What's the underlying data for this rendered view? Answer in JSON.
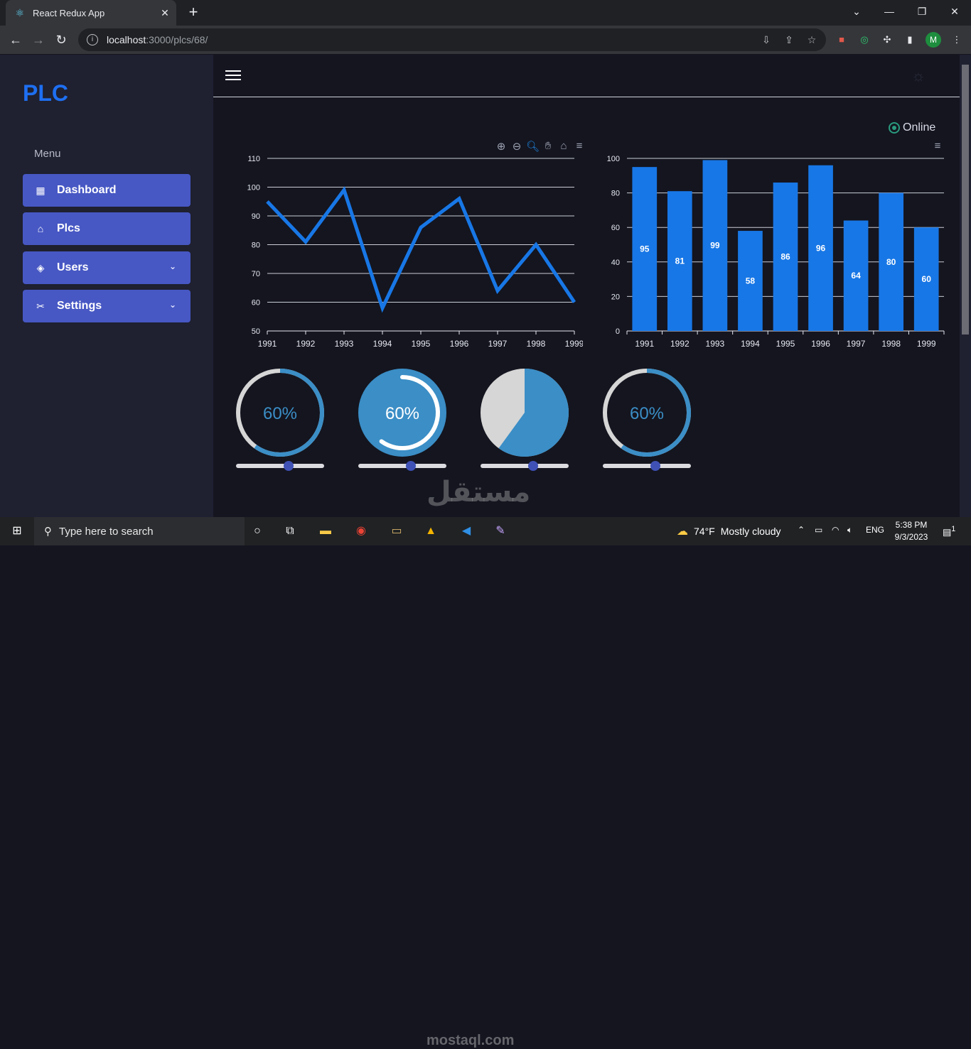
{
  "browser": {
    "tab_title": "React Redux App",
    "url_host": "localhost",
    "url_path": ":3000/plcs/68/",
    "profile_initial": "M"
  },
  "sidebar": {
    "brand": "PLC",
    "menu_label": "Menu",
    "items": [
      {
        "label": "Dashboard",
        "icon": "grid-icon",
        "has_chevron": false
      },
      {
        "label": "Plcs",
        "icon": "router-icon",
        "has_chevron": false
      },
      {
        "label": "Users",
        "icon": "layers-icon",
        "has_chevron": true
      },
      {
        "label": "Settings",
        "icon": "tools-icon",
        "has_chevron": true
      }
    ]
  },
  "status": {
    "label": "Online",
    "color": "#2a9a7e"
  },
  "chart_data": [
    {
      "type": "line",
      "categories": [
        "1991",
        "1992",
        "1993",
        "1994",
        "1995",
        "1996",
        "1997",
        "1998",
        "1999"
      ],
      "series": [
        {
          "values": [
            95,
            81,
            99,
            58,
            86,
            96,
            64,
            80,
            60
          ]
        }
      ],
      "yticks": [
        "50",
        "60",
        "70",
        "80",
        "90",
        "100",
        "110"
      ],
      "ylim": [
        50,
        110
      ],
      "color": "#1877e6",
      "grid": true
    },
    {
      "type": "bar",
      "categories": [
        "1991",
        "1992",
        "1993",
        "1994",
        "1995",
        "1996",
        "1997",
        "1998",
        "1999"
      ],
      "series": [
        {
          "values": [
            95,
            81,
            99,
            58,
            86,
            96,
            64,
            80,
            60
          ]
        }
      ],
      "yticks": [
        "0",
        "20",
        "40",
        "60",
        "80",
        "100"
      ],
      "ylim": [
        0,
        100
      ],
      "color": "#1877e6",
      "data_labels": [
        "95",
        "81",
        "99",
        "58",
        "86",
        "96",
        "64",
        "80",
        "60"
      ],
      "grid": true
    }
  ],
  "gauges": [
    {
      "label": "60%",
      "value": 0.6,
      "style": "ring"
    },
    {
      "label": "60%",
      "value": 0.6,
      "style": "filled-ring"
    },
    {
      "label": "",
      "value": 0.6,
      "style": "pie"
    },
    {
      "label": "60%",
      "value": 0.6,
      "style": "ring"
    }
  ],
  "sliders": [
    0.6,
    0.6,
    0.6,
    0.6
  ],
  "taskbar": {
    "search_placeholder": "Type here to search",
    "weather_temp": "74°F",
    "weather_desc": "Mostly cloudy",
    "language": "ENG",
    "time": "5:38 PM",
    "date": "9/3/2023",
    "notification_count": "1"
  },
  "watermark": {
    "arabic": "مستقل",
    "latin": "mostaql.com"
  }
}
